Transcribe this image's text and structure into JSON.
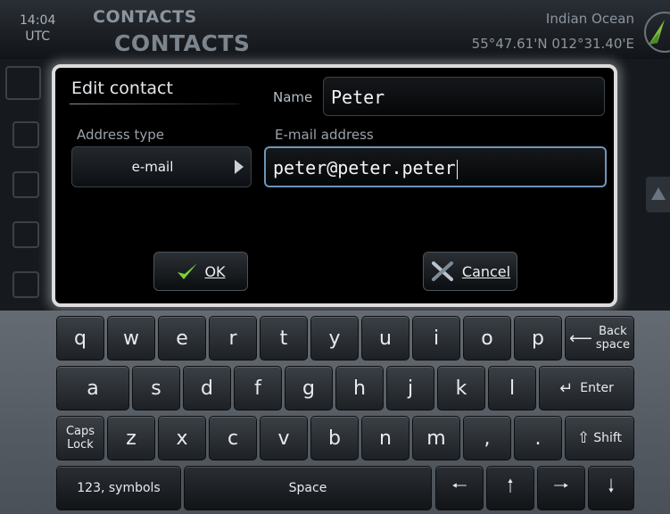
{
  "header": {
    "time": "14:04",
    "timezone": "UTC",
    "title_small": "CONTACTS",
    "title_large": "CONTACTS",
    "region": "Indian Ocean",
    "position": "55°47.61'N  012°31.40'E"
  },
  "dialog": {
    "title": "Edit contact",
    "name_label": "Name",
    "name_value": "Peter",
    "address_type_label": "Address type",
    "address_type_value": "e-mail",
    "email_label": "E-mail address",
    "email_value": "peter@peter.peter",
    "ok_label": "OK",
    "cancel_label": "Cancel"
  },
  "keyboard": {
    "row1": [
      "q",
      "w",
      "e",
      "r",
      "t",
      "y",
      "u",
      "i",
      "o",
      "p"
    ],
    "backspace_line1": "Back",
    "backspace_line2": "space",
    "row2": [
      "a",
      "s",
      "d",
      "f",
      "g",
      "h",
      "j",
      "k",
      "l"
    ],
    "enter": "Enter",
    "caps_line1": "Caps",
    "caps_line2": "Lock",
    "row3": [
      "z",
      "x",
      "c",
      "v",
      "b",
      "n",
      "m",
      ",",
      "."
    ],
    "shift": "Shift",
    "symbols": "123, symbols",
    "space": "Space"
  }
}
